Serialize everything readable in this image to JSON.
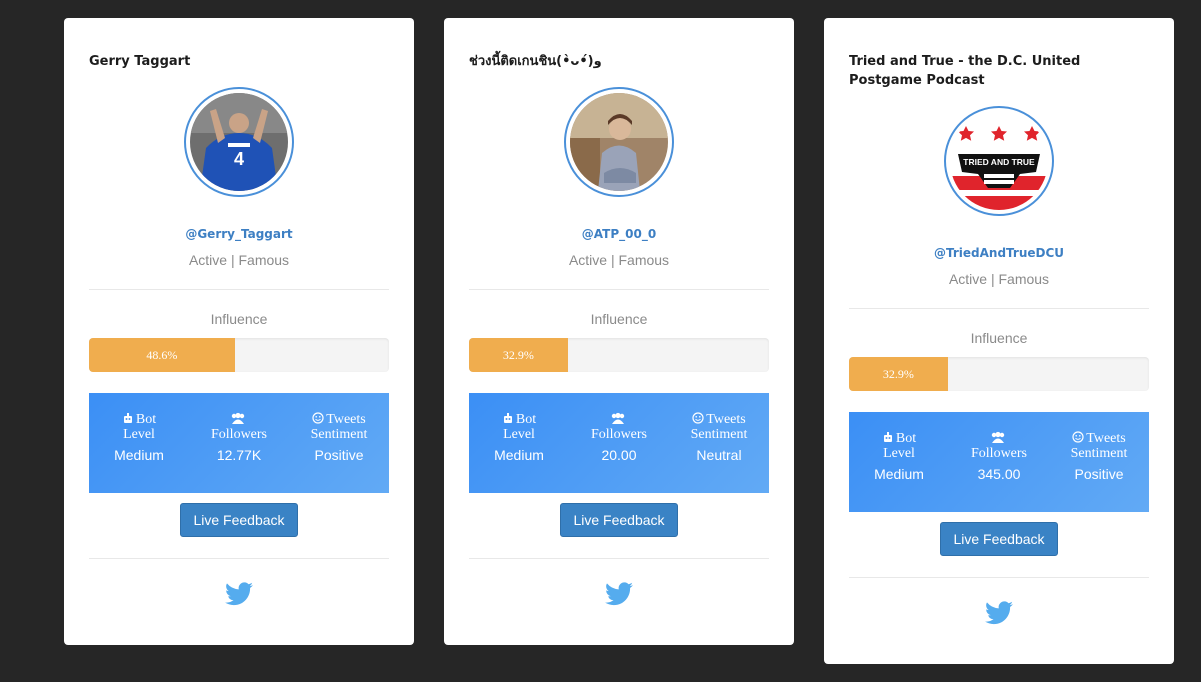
{
  "cards": [
    {
      "title": "Gerry Taggart",
      "handle": "@Gerry_Taggart",
      "status": "Active | Famous",
      "influence_label": "Influence",
      "influence_value": "48.6%",
      "influence_fraction": 0.486,
      "stats": {
        "bot_label_1": "Bot",
        "bot_label_2": "Level",
        "bot_value": "Medium",
        "followers_label": "Followers",
        "followers_value": "12.77K",
        "sentiment_label_1": "Tweets",
        "sentiment_label_2": "Sentiment",
        "sentiment_value": "Positive"
      },
      "button_label": "Live Feedback",
      "avatar": "profile-photo-soccer-player"
    },
    {
      "title": "ช่วงนี้ติดเกนชิน(•̀ᴗ•́)و",
      "handle": "@ATP_00_0",
      "status": "Active | Famous",
      "influence_label": "Influence",
      "influence_value": "32.9%",
      "influence_fraction": 0.329,
      "stats": {
        "bot_label_1": "Bot",
        "bot_label_2": "Level",
        "bot_value": "Medium",
        "followers_label": "Followers",
        "followers_value": "20.00",
        "sentiment_label_1": "Tweets",
        "sentiment_label_2": "Sentiment",
        "sentiment_value": "Neutral"
      },
      "button_label": "Live Feedback",
      "avatar": "profile-photo-person-sitting"
    },
    {
      "title": "Tried and True - the D.C. United Postgame Podcast",
      "handle": "@TriedAndTrueDCU",
      "status": "Active | Famous",
      "influence_label": "Influence",
      "influence_value": "32.9%",
      "influence_fraction": 0.329,
      "stats": {
        "bot_label_1": "Bot",
        "bot_label_2": "Level",
        "bot_value": "Medium",
        "followers_label": "Followers",
        "followers_value": "345.00",
        "sentiment_label_1": "Tweets",
        "sentiment_label_2": "Sentiment",
        "sentiment_value": "Positive"
      },
      "button_label": "Live Feedback",
      "avatar": "podcast-logo",
      "avatar_text": "TRIED AND TRUE"
    }
  ],
  "colors": {
    "page_bg": "#262626",
    "card_bg": "#ffffff",
    "accent_blue": "#3d7fc3",
    "progress_fill": "#f0ad4e",
    "button_bg": "#3a83c5",
    "twitter_blue": "#55acee"
  },
  "icons": {
    "bot": "bot-icon",
    "followers": "users-icon",
    "sentiment": "smile-icon",
    "social": "twitter-icon"
  }
}
